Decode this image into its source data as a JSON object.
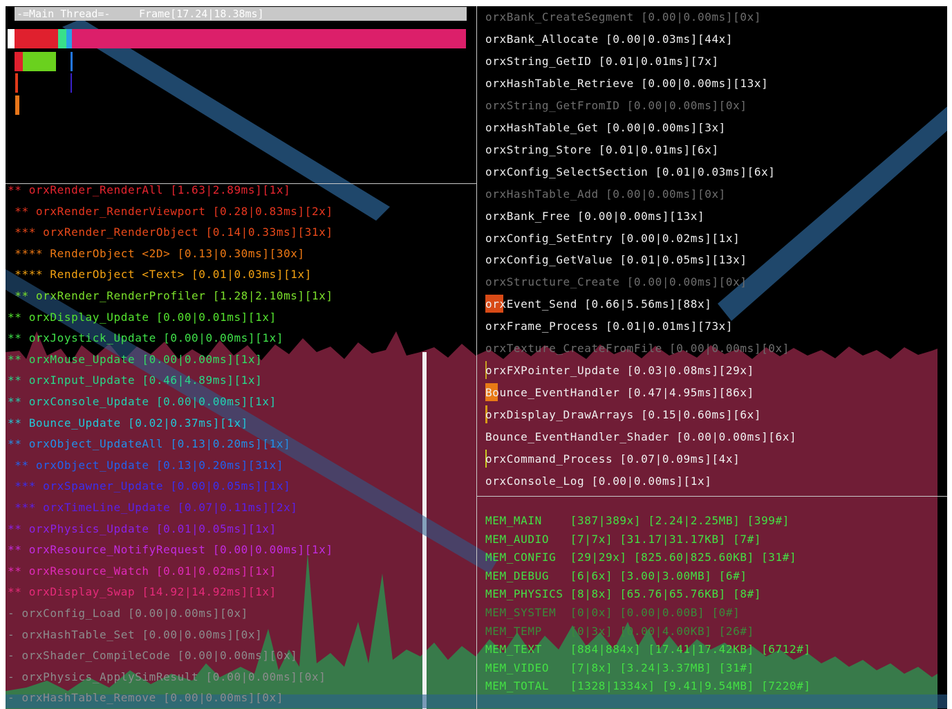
{
  "colors": {
    "background": "#000000",
    "graph_fill": "#7a1f3b",
    "graph_spike": "#2e8b4e",
    "frame_bar": "#dc1f6a",
    "overlay_band": "#2a5f8f",
    "divider": "#c9c9c9"
  },
  "header": {
    "thread_label": "-=Main Thread=-",
    "frame_label": "Frame[17.24|18.38ms]"
  },
  "markers": [
    {
      "text": "** orxRender_RenderAll [1.63|2.89ms][1x]",
      "color": "#e8252f",
      "faded": false
    },
    {
      "text": " ** orxRender_RenderViewport [0.28|0.83ms][2x]",
      "color": "#e8361f",
      "faded": false
    },
    {
      "text": " *** orxRender_RenderObject [0.14|0.33ms][31x]",
      "color": "#ea4a1a",
      "faded": false
    },
    {
      "text": " **** RenderObject <2D> [0.13|0.30ms][30x]",
      "color": "#f07a14",
      "faded": false
    },
    {
      "text": " **** RenderObject <Text> [0.01|0.03ms][1x]",
      "color": "#f5a312",
      "faded": false
    },
    {
      "text": " ** orxRender_RenderProfiler [1.28|2.10ms][1x]",
      "color": "#7be12b",
      "faded": false
    },
    {
      "text": "** orxDisplay_Update [0.00|0.01ms][1x]",
      "color": "#55e52f",
      "faded": false
    },
    {
      "text": "** orxJoystick_Update [0.00|0.00ms][1x]",
      "color": "#40e24a",
      "faded": false
    },
    {
      "text": "** orxMouse_Update [0.00|0.00ms][1x]",
      "color": "#32de64",
      "faded": false
    },
    {
      "text": "** orxInput_Update [0.46|4.89ms][1x]",
      "color": "#28d98a",
      "faded": false
    },
    {
      "text": "** orxConsole_Update [0.00|0.00ms][1x]",
      "color": "#22d2b0",
      "faded": false
    },
    {
      "text": "** Bounce_Update [0.02|0.37ms][1x]",
      "color": "#22c8d8",
      "faded": false
    },
    {
      "text": "** orxObject_UpdateAll [0.13|0.20ms][1x]",
      "color": "#2290e8",
      "faded": false
    },
    {
      "text": " ** orxObject_Update [0.13|0.20ms][31x]",
      "color": "#2262ee",
      "faded": false
    },
    {
      "text": " *** orxSpawner_Update [0.00|0.05ms][1x]",
      "color": "#3a2ff0",
      "faded": false
    },
    {
      "text": " *** orxTimeLine_Update [0.07|0.11ms][2x]",
      "color": "#5a20e8",
      "faded": false
    },
    {
      "text": "** orxPhysics_Update [0.01|0.05ms][1x]",
      "color": "#8a22e6",
      "faded": false
    },
    {
      "text": "** orxResource_NotifyRequest [0.00|0.00ms][1x]",
      "color": "#c22ce0",
      "faded": false
    },
    {
      "text": "** orxResource_Watch [0.01|0.02ms][1x]",
      "color": "#e02ab8",
      "faded": false
    },
    {
      "text": "** orxDisplay_Swap [14.92|14.92ms][1x]",
      "color": "#e62a7a",
      "faded": false
    },
    {
      "text": "- orxConfig_Load [0.00|0.00ms][0x]",
      "color": "#8c8c8c",
      "faded": true
    },
    {
      "text": "- orxHashTable_Set [0.00|0.00ms][0x]",
      "color": "#8c8c8c",
      "faded": true
    },
    {
      "text": "- orxShader_CompileCode [0.00|0.00ms][0x]",
      "color": "#8c8c8c",
      "faded": true
    },
    {
      "text": "- orxPhysics_ApplySimResult [0.00|0.00ms][0x]",
      "color": "#8c8c8c",
      "faded": true
    },
    {
      "text": "- orxHashTable_Remove [0.00|0.00ms][0x]",
      "color": "#8c8c8c",
      "faded": true
    }
  ],
  "functions": [
    {
      "text": "orxBank_CreateSegment [0.00|0.00ms][0x]",
      "faded": true
    },
    {
      "text": "orxBank_Allocate [0.00|0.03ms][44x]",
      "faded": false
    },
    {
      "text": "orxString_GetID [0.01|0.01ms][7x]",
      "faded": false
    },
    {
      "text": "orxHashTable_Retrieve [0.00|0.00ms][13x]",
      "faded": false
    },
    {
      "text": "orxString_GetFromID [0.00|0.00ms][0x]",
      "faded": true
    },
    {
      "text": "orxHashTable_Get [0.00|0.00ms][3x]",
      "faded": false
    },
    {
      "text": "orxString_Store [0.01|0.01ms][6x]",
      "faded": false
    },
    {
      "text": "orxConfig_SelectSection [0.01|0.03ms][6x]",
      "faded": false
    },
    {
      "text": "orxHashTable_Add [0.00|0.00ms][0x]",
      "faded": true
    },
    {
      "text": "orxBank_Free [0.00|0.00ms][13x]",
      "faded": false
    },
    {
      "text": "orxConfig_SetEntry [0.00|0.02ms][1x]",
      "faded": false
    },
    {
      "text": "orxConfig_GetValue [0.01|0.05ms][13x]",
      "faded": false
    },
    {
      "text": "orxStructure_Create [0.00|0.00ms][0x]",
      "faded": true
    },
    {
      "text": "orxEvent_Send [0.66|5.56ms][88x]",
      "faded": false
    },
    {
      "text": "orxFrame_Process [0.01|0.01ms][73x]",
      "faded": false
    },
    {
      "text": "orxTexture_CreateFromFile [0.00|0.00ms][0x]",
      "faded": true
    },
    {
      "text": "orxFXPointer_Update [0.03|0.08ms][29x]",
      "faded": false
    },
    {
      "text": "Bounce_EventHandler [0.47|4.95ms][86x]",
      "faded": false
    },
    {
      "text": "orxDisplay_DrawArrays [0.15|0.60ms][6x]",
      "faded": false
    },
    {
      "text": "Bounce_EventHandler_Shader [0.00|0.00ms][6x]",
      "faded": false
    },
    {
      "text": "orxCommand_Process [0.07|0.09ms][4x]",
      "faded": false
    },
    {
      "text": "orxConsole_Log [0.00|0.00ms][1x]",
      "faded": false
    }
  ],
  "memory": [
    {
      "text": "MEM_MAIN    [387|389x] [2.24|2.25MB] [399#]",
      "faded": false
    },
    {
      "text": "MEM_AUDIO   [7|7x] [31.17|31.17KB] [7#]",
      "faded": false
    },
    {
      "text": "MEM_CONFIG  [29|29x] [825.60|825.60KB] [31#]",
      "faded": false
    },
    {
      "text": "MEM_DEBUG   [6|6x] [3.00|3.00MB] [6#]",
      "faded": false
    },
    {
      "text": "MEM_PHYSICS [8|8x] [65.76|65.76KB] [8#]",
      "faded": false
    },
    {
      "text": "MEM_SYSTEM  [0|0x] [0.00|0.00B] [0#]",
      "faded": true
    },
    {
      "text": "MEM_TEMP    [0|3x] [0.00|4.00KB] [26#]",
      "faded": true
    },
    {
      "text": "MEM_TEXT    [884|884x] [17.41|17.42KB] [6712#]",
      "faded": false
    },
    {
      "text": "MEM_VIDEO   [7|8x] [3.24|3.37MB] [31#]",
      "faded": false
    },
    {
      "text": "MEM_TOTAL   [1328|1334x] [9.41|9.54MB] [7220#]",
      "faded": false
    }
  ]
}
